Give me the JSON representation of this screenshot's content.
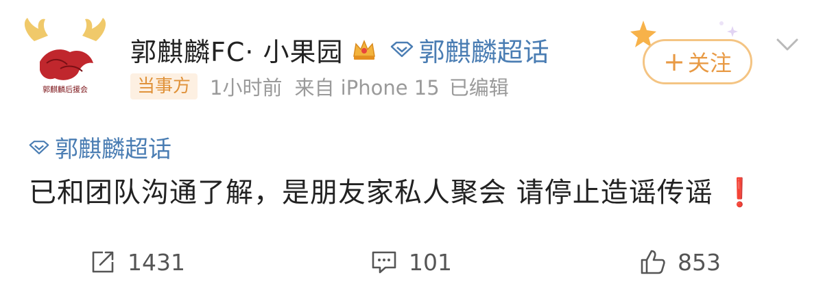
{
  "post": {
    "username": "郭麒麟FC· 小果园",
    "verified_topic_inline": "郭麒麟超话",
    "party_badge": "当事方",
    "time": "1小时前",
    "source": "来自 iPhone 15",
    "edited": "已编辑",
    "follow_label": "关注",
    "follow_plus": "+",
    "topic_tag": "郭麒麟超话",
    "content": "已和团队沟通了解，是朋友家私人聚会 请停止造谣传谣",
    "content_emoji": "❗",
    "avatar_text": "郭麒麟后援会"
  },
  "actions": {
    "repost_count": "1431",
    "comment_count": "101",
    "like_count": "853"
  },
  "icons": {
    "avatar": "fan-club-logo-icon",
    "crown": "crown-icon",
    "diamond": "super-topic-diamond-icon",
    "chevron": "chevron-down-icon",
    "repost": "repost-icon",
    "comment": "comment-icon",
    "like": "thumbs-up-icon"
  },
  "colors": {
    "link_blue": "#4a7db3",
    "follow_orange": "#e89a45",
    "badge_bg": "#fdf0e2",
    "exclamation_red": "#e0302a"
  }
}
